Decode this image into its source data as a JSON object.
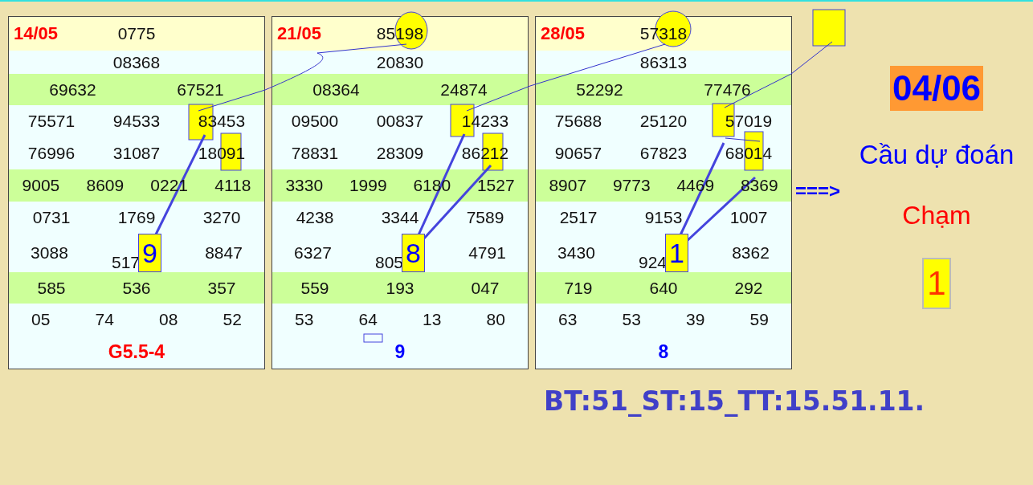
{
  "cards": [
    {
      "date": "14/05",
      "special": "0775",
      "first_prize": "08368",
      "pick_digit": "9",
      "footer": {
        "text": "G5.5-4",
        "color": "#ff0000"
      },
      "prizes": [
        {
          "highlighted": true,
          "numbers": [
            "69632",
            "67521"
          ]
        },
        {
          "highlighted": false,
          "numbers": [
            "75571",
            "94533",
            "83453"
          ]
        },
        {
          "highlighted": false,
          "numbers": [
            "76996",
            "31087",
            "18091"
          ]
        },
        {
          "highlighted": true,
          "numbers": [
            "9005",
            "8609",
            "0221",
            "4118"
          ]
        },
        {
          "highlighted": false,
          "numbers": [
            "0731",
            "1769",
            "3270"
          ]
        },
        {
          "highlighted": false,
          "numbers": [
            "3088",
            "517",
            "8847"
          ]
        },
        {
          "highlighted": true,
          "numbers": [
            "585",
            "536",
            "357"
          ]
        },
        {
          "highlighted": false,
          "numbers": [
            "05",
            "74",
            "08",
            "52"
          ]
        }
      ]
    },
    {
      "date": "21/05",
      "special": "85198",
      "first_prize": "20830",
      "pick_digit": "8",
      "footer": {
        "text": "9",
        "color": "#0000ff"
      },
      "prizes": [
        {
          "highlighted": true,
          "numbers": [
            "08364",
            "24874"
          ]
        },
        {
          "highlighted": false,
          "numbers": [
            "09500",
            "00837",
            "14233"
          ]
        },
        {
          "highlighted": false,
          "numbers": [
            "78831",
            "28309",
            "86212"
          ]
        },
        {
          "highlighted": true,
          "numbers": [
            "3330",
            "1999",
            "6180",
            "1527"
          ]
        },
        {
          "highlighted": false,
          "numbers": [
            "4238",
            "3344",
            "7589"
          ]
        },
        {
          "highlighted": false,
          "numbers": [
            "6327",
            "805",
            "4791"
          ]
        },
        {
          "highlighted": true,
          "numbers": [
            "559",
            "193",
            "047"
          ]
        },
        {
          "highlighted": false,
          "numbers": [
            "53",
            "64",
            "13",
            "80"
          ]
        }
      ]
    },
    {
      "date": "28/05",
      "special": "57318",
      "first_prize": "86313",
      "pick_digit": "1",
      "footer": {
        "text": "8",
        "color": "#0000ff"
      },
      "prizes": [
        {
          "highlighted": true,
          "numbers": [
            "52292",
            "77476"
          ]
        },
        {
          "highlighted": false,
          "numbers": [
            "75688",
            "25120",
            "57019"
          ]
        },
        {
          "highlighted": false,
          "numbers": [
            "90657",
            "67823",
            "68014"
          ]
        },
        {
          "highlighted": true,
          "numbers": [
            "8907",
            "9773",
            "4469",
            "8369"
          ]
        },
        {
          "highlighted": false,
          "numbers": [
            "2517",
            "9153",
            "1007"
          ]
        },
        {
          "highlighted": false,
          "numbers": [
            "3430",
            "924",
            "8362"
          ]
        },
        {
          "highlighted": true,
          "numbers": [
            "719",
            "640",
            "292"
          ]
        },
        {
          "highlighted": false,
          "numbers": [
            "63",
            "53",
            "39",
            "59"
          ]
        }
      ]
    }
  ],
  "arrow": "===>",
  "prediction": {
    "date": "04/06",
    "title": "Cầu dự đoán",
    "label": "Chạm",
    "digit": "1"
  },
  "summary": "BT:51_ST:15_TT:15.51.11."
}
